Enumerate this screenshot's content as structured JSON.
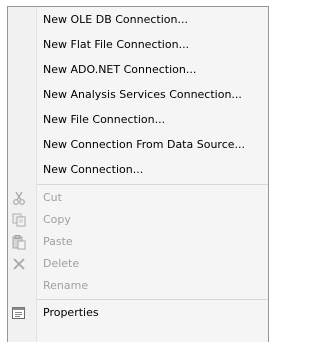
{
  "menu": {
    "items": [
      {
        "label": "New OLE DB Connection...",
        "enabled": true
      },
      {
        "label": "New Flat File Connection...",
        "enabled": true
      },
      {
        "label": "New ADO.NET Connection...",
        "enabled": true
      },
      {
        "label": "New Analysis Services Connection...",
        "enabled": true
      },
      {
        "label": "New File Connection...",
        "enabled": true
      },
      {
        "label": "New Connection From Data Source...",
        "enabled": true
      },
      {
        "label": "New Connection...",
        "enabled": true
      },
      {
        "label": "Cut",
        "enabled": false,
        "icon": "scissors-icon"
      },
      {
        "label": "Copy",
        "enabled": false,
        "icon": "copy-icon"
      },
      {
        "label": "Paste",
        "enabled": false,
        "icon": "paste-icon"
      },
      {
        "label": "Delete",
        "enabled": false,
        "icon": "delete-x-icon"
      },
      {
        "label": "Rename",
        "enabled": false
      },
      {
        "label": "Properties",
        "enabled": true,
        "icon": "properties-icon"
      }
    ]
  },
  "colors": {
    "menu_background": "#f5f5f5",
    "gutter_background": "#f1f1f1",
    "border": "#979797",
    "separator": "#d7d7d7",
    "disabled_text": "#a0a0a0"
  }
}
